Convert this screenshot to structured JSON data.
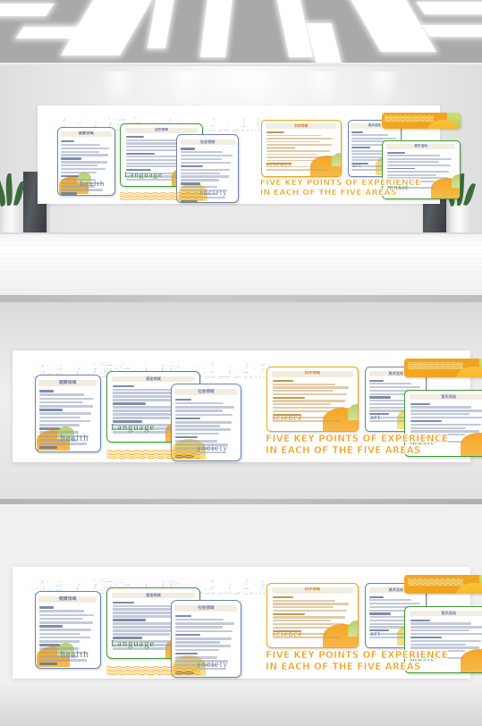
{
  "poster": {
    "title_cn": "各年龄段五大领域关键经验要点",
    "slogan_line1": "FIVE KEY POINTS OF EXPERIENCE",
    "slogan_line2": "IN EACH OF THE FIVE AREAS",
    "colors": {
      "title_blue": "#7f93b5",
      "accent_orange": "#f0a21e",
      "accent_green": "#4a8a3c",
      "card_head_bg": "#f3ece2",
      "blue_border": "#6d83a8",
      "green_border": "#3f9a34",
      "orange_border": "#f0a21e"
    },
    "cards": [
      {
        "id": "health",
        "head_cn": "健康领域",
        "en": "health",
        "border": "blue",
        "sun": "orange"
      },
      {
        "id": "language",
        "head_cn": "语言领域",
        "en": "Language",
        "border": "green",
        "sun": "orange"
      },
      {
        "id": "society",
        "head_cn": "社会领域",
        "en": "society",
        "border": "blue",
        "sun": "pale"
      },
      {
        "id": "science",
        "head_cn": "科学领域",
        "en": "science",
        "border": "orange",
        "sun": "orange"
      },
      {
        "id": "art",
        "head_cn": "美术活动",
        "en": "art",
        "border": "blue",
        "sun": "pale"
      },
      {
        "id": "music",
        "head_cn": "音乐活动",
        "en": "music",
        "border": "green",
        "sun": "orange"
      }
    ],
    "decor": {
      "banner_label": "orange-gradient-banner",
      "wave_label": "orange-wave-ribbon"
    }
  },
  "scene": {
    "name": "exhibition-hall-mockup",
    "ceiling_light_count": 9,
    "plant_left": "potted-plant-left",
    "plant_right": "potted-plant-right",
    "pillar_left": "dark-stone-pillar-left",
    "pillar_right": "dark-stone-pillar-right"
  }
}
